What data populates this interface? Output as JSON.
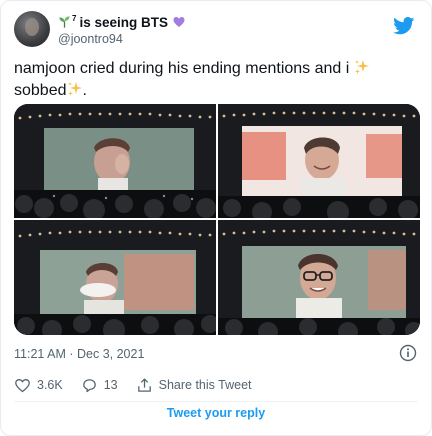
{
  "user": {
    "display_name": "is seeing BTS",
    "display_sup": "7",
    "handle": "@joontro94",
    "name_icons": [
      "sprout-icon",
      "purple-heart-icon"
    ]
  },
  "tweet": {
    "text_line1": "namjoon cried during his ending mentions and i",
    "text_line2": "sobbed",
    "text_line2_end": ".",
    "emoji": "sparkles-icon"
  },
  "media": {
    "count": 4,
    "tiles": [
      "concert-screen-crying-1",
      "concert-screen-smiling",
      "concert-screen-wiping-tears",
      "concert-screen-glasses"
    ]
  },
  "meta": {
    "timestamp": "11:21 AM · Dec 3, 2021"
  },
  "actions": {
    "likes": "3.6K",
    "replies": "13",
    "share_label": "Share this Tweet"
  },
  "reply_button_label": "Tweet your reply",
  "colors": {
    "brand": "#1d9bf0",
    "text_primary": "#0f1419",
    "text_secondary": "#536471",
    "heart_purple": "#a47ce0",
    "sprout_green": "#58a55c",
    "sparkle_yellow": "#f7c04a"
  }
}
